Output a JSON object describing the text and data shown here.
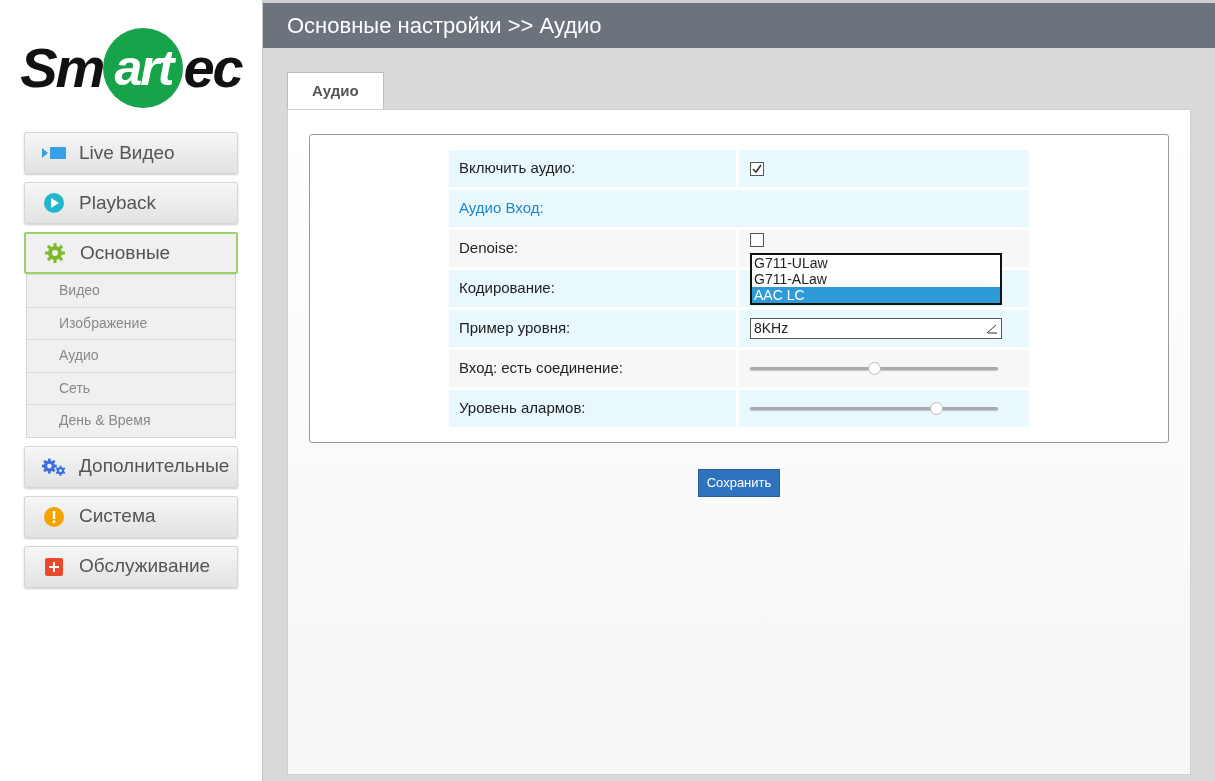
{
  "logo": {
    "before": "Sm",
    "circled": "art",
    "after": "ec"
  },
  "sidebar": {
    "items": [
      {
        "label": "Live Видео",
        "selected": false
      },
      {
        "label": "Playback",
        "selected": false
      },
      {
        "label": "Основные",
        "selected": true,
        "children": [
          {
            "label": "Видео"
          },
          {
            "label": "Изображение"
          },
          {
            "label": "Аудио"
          },
          {
            "label": "Сеть"
          },
          {
            "label": "День & Время"
          }
        ]
      },
      {
        "label": "Дополнительные",
        "selected": false
      },
      {
        "label": "Система",
        "selected": false
      },
      {
        "label": "Обслуживание",
        "selected": false
      }
    ]
  },
  "header": {
    "title": "Основные настройки >> Аудио"
  },
  "tabs": [
    {
      "label": "Аудио",
      "selected": true
    }
  ],
  "rows": [
    {
      "kind": "checkbox",
      "label": "Включить аудио:",
      "checked": true
    },
    {
      "kind": "heading",
      "label": "Аудио Вход:"
    },
    {
      "kind": "checkbox",
      "label": "Denoise:",
      "checked": false
    },
    {
      "kind": "dropdown",
      "label": "Кодирование:",
      "options": [
        {
          "label": "G711-ULaw",
          "selected": false
        },
        {
          "label": "G711-ALaw",
          "selected": false
        },
        {
          "label": "AAC LC",
          "selected": true
        }
      ]
    },
    {
      "kind": "select",
      "label": "Пример уровня:",
      "value": "8KHz"
    },
    {
      "kind": "slider",
      "label": "Вход: есть соединение:",
      "level": 0.5
    },
    {
      "kind": "slider",
      "label": "Уровень алармов:",
      "level": 0.75
    }
  ],
  "save_button": "Сохранить"
}
